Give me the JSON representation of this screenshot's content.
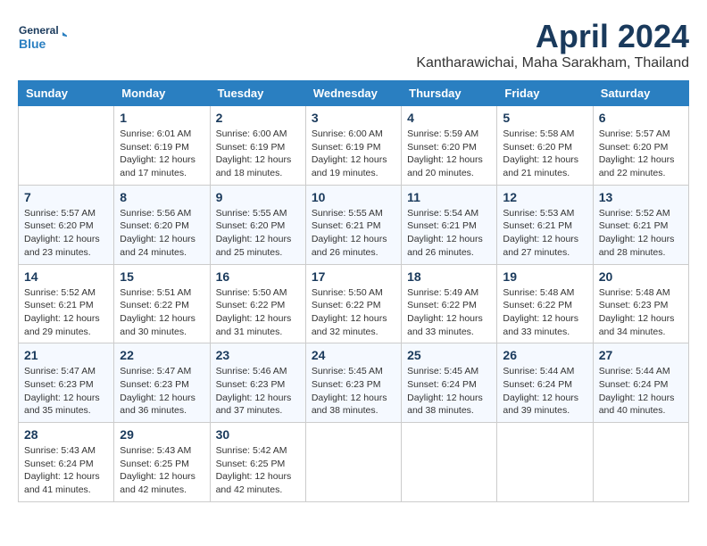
{
  "header": {
    "logo_line1": "General",
    "logo_line2": "Blue",
    "month_year": "April 2024",
    "location": "Kantharawichai, Maha Sarakham, Thailand"
  },
  "weekdays": [
    "Sunday",
    "Monday",
    "Tuesday",
    "Wednesday",
    "Thursday",
    "Friday",
    "Saturday"
  ],
  "weeks": [
    [
      {
        "day": "",
        "info": ""
      },
      {
        "day": "1",
        "info": "Sunrise: 6:01 AM\nSunset: 6:19 PM\nDaylight: 12 hours\nand 17 minutes."
      },
      {
        "day": "2",
        "info": "Sunrise: 6:00 AM\nSunset: 6:19 PM\nDaylight: 12 hours\nand 18 minutes."
      },
      {
        "day": "3",
        "info": "Sunrise: 6:00 AM\nSunset: 6:19 PM\nDaylight: 12 hours\nand 19 minutes."
      },
      {
        "day": "4",
        "info": "Sunrise: 5:59 AM\nSunset: 6:20 PM\nDaylight: 12 hours\nand 20 minutes."
      },
      {
        "day": "5",
        "info": "Sunrise: 5:58 AM\nSunset: 6:20 PM\nDaylight: 12 hours\nand 21 minutes."
      },
      {
        "day": "6",
        "info": "Sunrise: 5:57 AM\nSunset: 6:20 PM\nDaylight: 12 hours\nand 22 minutes."
      }
    ],
    [
      {
        "day": "7",
        "info": "Sunrise: 5:57 AM\nSunset: 6:20 PM\nDaylight: 12 hours\nand 23 minutes."
      },
      {
        "day": "8",
        "info": "Sunrise: 5:56 AM\nSunset: 6:20 PM\nDaylight: 12 hours\nand 24 minutes."
      },
      {
        "day": "9",
        "info": "Sunrise: 5:55 AM\nSunset: 6:20 PM\nDaylight: 12 hours\nand 25 minutes."
      },
      {
        "day": "10",
        "info": "Sunrise: 5:55 AM\nSunset: 6:21 PM\nDaylight: 12 hours\nand 26 minutes."
      },
      {
        "day": "11",
        "info": "Sunrise: 5:54 AM\nSunset: 6:21 PM\nDaylight: 12 hours\nand 26 minutes."
      },
      {
        "day": "12",
        "info": "Sunrise: 5:53 AM\nSunset: 6:21 PM\nDaylight: 12 hours\nand 27 minutes."
      },
      {
        "day": "13",
        "info": "Sunrise: 5:52 AM\nSunset: 6:21 PM\nDaylight: 12 hours\nand 28 minutes."
      }
    ],
    [
      {
        "day": "14",
        "info": "Sunrise: 5:52 AM\nSunset: 6:21 PM\nDaylight: 12 hours\nand 29 minutes."
      },
      {
        "day": "15",
        "info": "Sunrise: 5:51 AM\nSunset: 6:22 PM\nDaylight: 12 hours\nand 30 minutes."
      },
      {
        "day": "16",
        "info": "Sunrise: 5:50 AM\nSunset: 6:22 PM\nDaylight: 12 hours\nand 31 minutes."
      },
      {
        "day": "17",
        "info": "Sunrise: 5:50 AM\nSunset: 6:22 PM\nDaylight: 12 hours\nand 32 minutes."
      },
      {
        "day": "18",
        "info": "Sunrise: 5:49 AM\nSunset: 6:22 PM\nDaylight: 12 hours\nand 33 minutes."
      },
      {
        "day": "19",
        "info": "Sunrise: 5:48 AM\nSunset: 6:22 PM\nDaylight: 12 hours\nand 33 minutes."
      },
      {
        "day": "20",
        "info": "Sunrise: 5:48 AM\nSunset: 6:23 PM\nDaylight: 12 hours\nand 34 minutes."
      }
    ],
    [
      {
        "day": "21",
        "info": "Sunrise: 5:47 AM\nSunset: 6:23 PM\nDaylight: 12 hours\nand 35 minutes."
      },
      {
        "day": "22",
        "info": "Sunrise: 5:47 AM\nSunset: 6:23 PM\nDaylight: 12 hours\nand 36 minutes."
      },
      {
        "day": "23",
        "info": "Sunrise: 5:46 AM\nSunset: 6:23 PM\nDaylight: 12 hours\nand 37 minutes."
      },
      {
        "day": "24",
        "info": "Sunrise: 5:45 AM\nSunset: 6:23 PM\nDaylight: 12 hours\nand 38 minutes."
      },
      {
        "day": "25",
        "info": "Sunrise: 5:45 AM\nSunset: 6:24 PM\nDaylight: 12 hours\nand 38 minutes."
      },
      {
        "day": "26",
        "info": "Sunrise: 5:44 AM\nSunset: 6:24 PM\nDaylight: 12 hours\nand 39 minutes."
      },
      {
        "day": "27",
        "info": "Sunrise: 5:44 AM\nSunset: 6:24 PM\nDaylight: 12 hours\nand 40 minutes."
      }
    ],
    [
      {
        "day": "28",
        "info": "Sunrise: 5:43 AM\nSunset: 6:24 PM\nDaylight: 12 hours\nand 41 minutes."
      },
      {
        "day": "29",
        "info": "Sunrise: 5:43 AM\nSunset: 6:25 PM\nDaylight: 12 hours\nand 42 minutes."
      },
      {
        "day": "30",
        "info": "Sunrise: 5:42 AM\nSunset: 6:25 PM\nDaylight: 12 hours\nand 42 minutes."
      },
      {
        "day": "",
        "info": ""
      },
      {
        "day": "",
        "info": ""
      },
      {
        "day": "",
        "info": ""
      },
      {
        "day": "",
        "info": ""
      }
    ]
  ]
}
